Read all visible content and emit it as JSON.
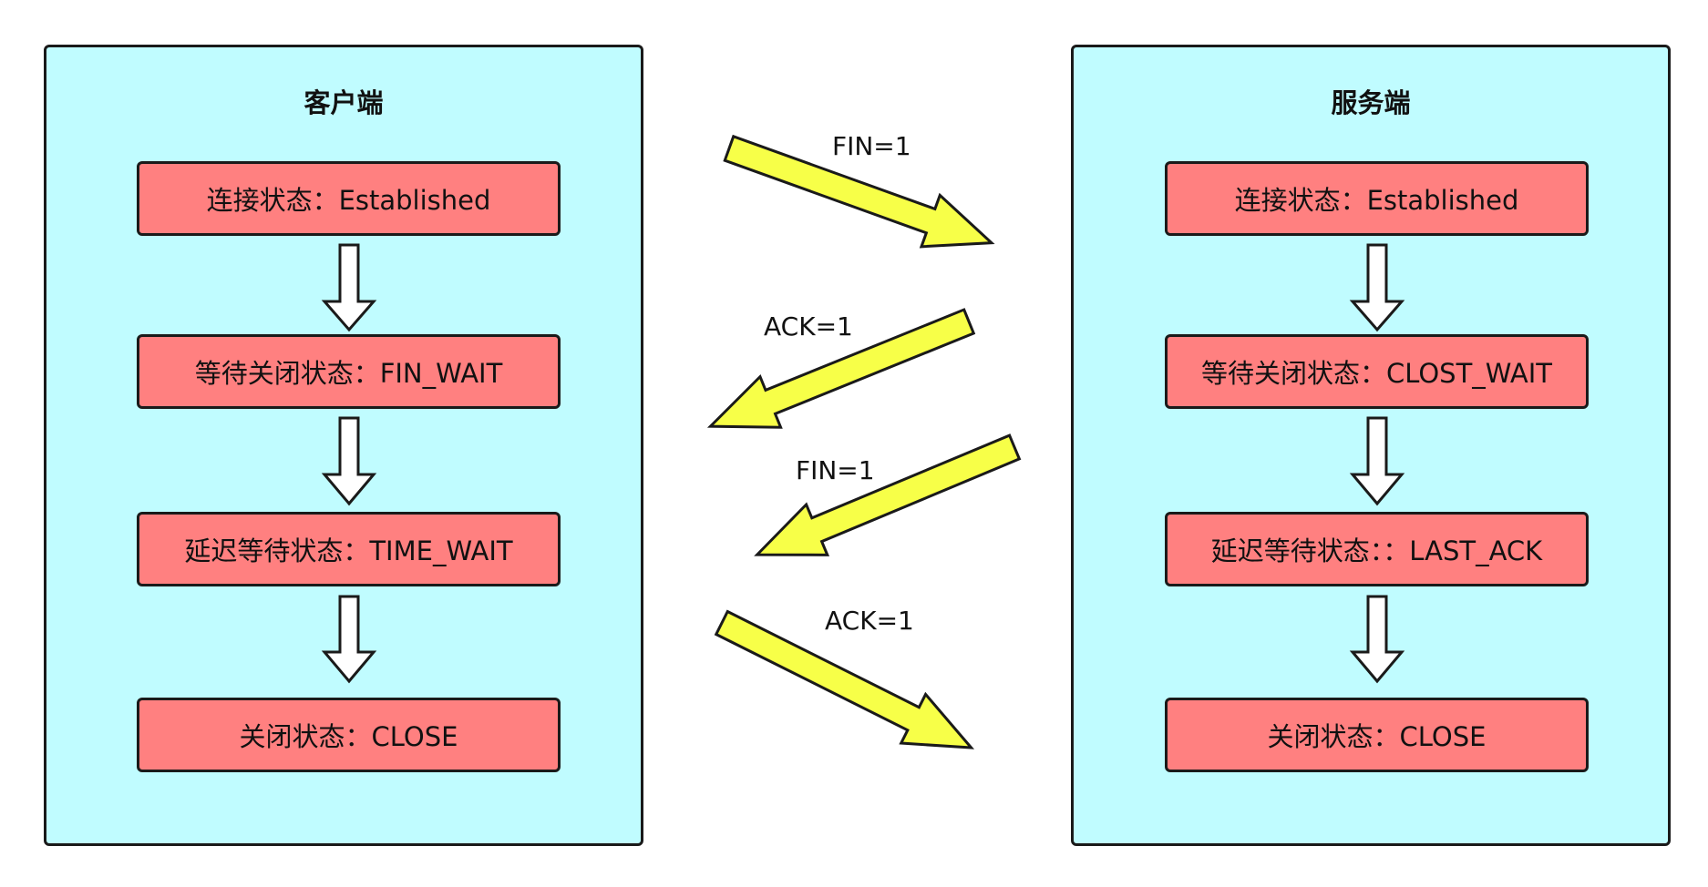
{
  "client": {
    "title": "客户端",
    "states": [
      "连接状态：Established",
      "等待关闭状态：FIN_WAIT",
      "延迟等待状态：TIME_WAIT",
      "关闭状态：CLOSE"
    ]
  },
  "server": {
    "title": "服务端",
    "states": [
      "连接状态：Established",
      "等待关闭状态：CLOST_WAIT",
      "延迟等待状态：：LAST_ACK",
      "关闭状态：CLOSE"
    ]
  },
  "messages": [
    {
      "label": "FIN=1",
      "direction": "client-to-server"
    },
    {
      "label": "ACK=1",
      "direction": "server-to-client"
    },
    {
      "label": "FIN=1",
      "direction": "server-to-client"
    },
    {
      "label": "ACK=1",
      "direction": "client-to-server"
    }
  ],
  "colors": {
    "panel": "#c0fcff",
    "state_box": "#ff8080",
    "message_arrow": "#f7ff48",
    "outline": "#1a1a1a"
  }
}
